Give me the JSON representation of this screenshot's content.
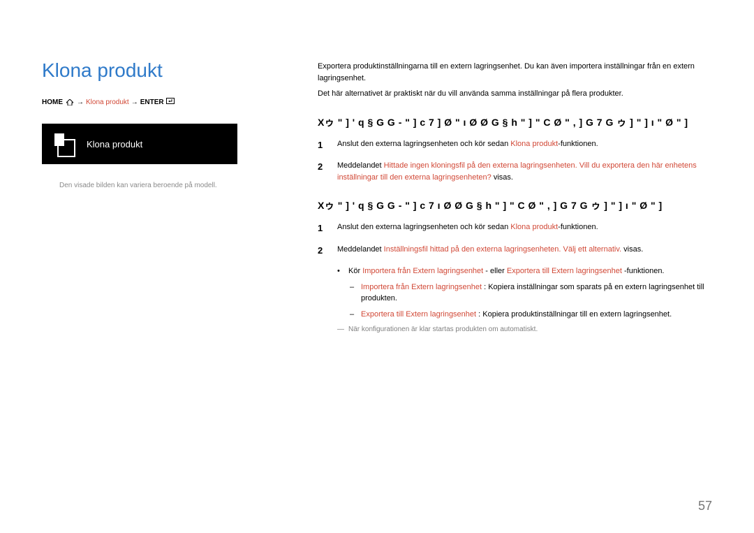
{
  "title": "Klona produkt",
  "breadcrumb": {
    "home": "HOME",
    "product": "Klona produkt",
    "enter": "ENTER",
    "arrow": "→"
  },
  "card": {
    "label": "Klona produkt"
  },
  "figure_caption": "Den visade bilden kan variera beroende på modell.",
  "intro": {
    "p1": "Exportera produktinställningarna till en extern lagringsenhet. Du kan även importera inställningar från en extern lagringsenhet.",
    "p2": "Det här alternativet är praktiskt när du vill använda samma inställningar på flera produkter."
  },
  "section1": {
    "heading": "Xゥ \" ] ' q § G G - \" ] c 7 ] Ø \" ı Ø Ø G § h \" ] \" C Ø \" , ] G 7 G ゥ ] \" ] ı \" Ø \" ]",
    "steps": {
      "0": {
        "num": "1",
        "pre": "Anslut den externa lagringsenheten och kör sedan ",
        "red": "Klona produkt",
        "post": "-funktionen."
      },
      "1": {
        "num": "2",
        "pre": "Meddelandet ",
        "red": "Hittade ingen kloningsfil på den externa lagringsenheten. Vill du exportera den här enhetens inställningar till den externa lagringsenheten?",
        "post": " visas."
      }
    }
  },
  "section2": {
    "heading": "Xゥ \" ] ' q § G G - \" ] c 7 ı Ø Ø G § h \" ] \" C Ø \" , ] G 7 G ゥ ] \" ] ı \" Ø \" ]",
    "steps": {
      "0": {
        "num": "1",
        "pre": "Anslut den externa lagringsenheten och kör sedan ",
        "red": "Klona produkt",
        "post": "-funktionen."
      },
      "1": {
        "num": "2",
        "pre": "Meddelandet ",
        "red": "Inställningsfil hittad på den externa lagringsenheten. Välj ett alternativ.",
        "post": " visas."
      }
    },
    "bullets": {
      "0": {
        "pre": "Kör ",
        "r1": "Importera från Extern lagringsenhet",
        "mid": " - eller ",
        "r2": "Exportera till Extern lagringsenhet",
        "post": " -funktionen."
      },
      "1": {
        "r": "Importera från Extern lagringsenhet",
        "txt": " : Kopiera inställningar som sparats på en extern lagringsenhet till produkten."
      },
      "2": {
        "r": "Exportera till Extern lagringsenhet",
        "txt": " : Kopiera produktinställningar till en extern lagringsenhet."
      }
    },
    "footnote": "När konfigurationen är klar startas produkten om automatiskt."
  },
  "page_number": "57"
}
